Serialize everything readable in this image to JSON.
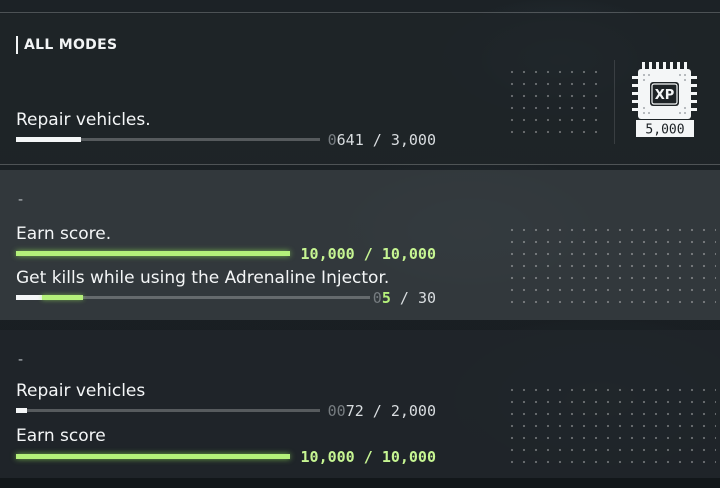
{
  "section1": {
    "heading": "ALL MODES",
    "objectives": [
      {
        "text": "Repair vehicles.",
        "count_dim": "0",
        "current": "641",
        "separator": "/",
        "total": "3,000",
        "progress": 0.214,
        "completed": false
      }
    ],
    "reward": {
      "label": "XP",
      "amount": "5,000",
      "icon": "xp-chip-icon"
    }
  },
  "section2": {
    "dash": "-",
    "objectives": [
      {
        "text": "Earn score.",
        "count_dim": "",
        "current": "10,000",
        "separator": "/",
        "total": "10,000",
        "progress": 1.0,
        "completed": true
      },
      {
        "text": "Get kills while using the Adrenaline Injector.",
        "count_dim": "0",
        "current": "5",
        "separator": "/",
        "total": "30",
        "progress": 0.167,
        "completed": false
      }
    ]
  },
  "section3": {
    "dash": "-",
    "objectives": [
      {
        "text": "Repair vehicles",
        "count_dim": "00",
        "current": "72",
        "separator": "/",
        "total": "2,000",
        "progress": 0.036,
        "completed": false
      },
      {
        "text": "Earn score",
        "count_dim": "",
        "current": "10,000",
        "separator": "/",
        "total": "10,000",
        "progress": 1.0,
        "completed": true
      }
    ]
  },
  "colors": {
    "accent_green": "#b4f07a",
    "text": "#f2f4f5",
    "dim": "#767c80"
  }
}
